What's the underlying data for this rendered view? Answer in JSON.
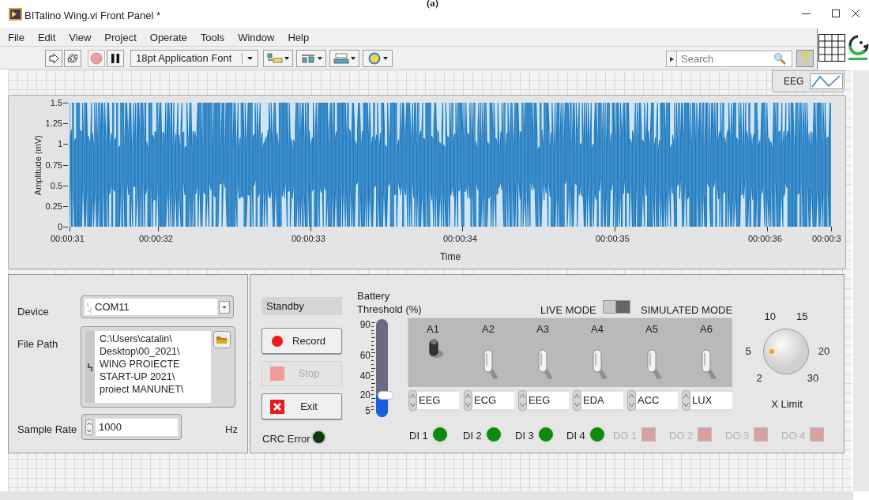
{
  "figure_label": "(a)",
  "window": {
    "title": "BITalino Wing.vi Front Panel *"
  },
  "menu": [
    "File",
    "Edit",
    "View",
    "Project",
    "Operate",
    "Tools",
    "Window",
    "Help"
  ],
  "toolbar": {
    "font": "18pt Application Font"
  },
  "search": {
    "placeholder": "Search"
  },
  "legend": {
    "label": "EEG"
  },
  "chart": {
    "ylabel": "Amplitude (mV)",
    "xlabel": "Time",
    "yticks": [
      "1.5",
      "1.25",
      "1",
      "0.75",
      "0.5",
      "0.25",
      "0"
    ],
    "xticks": [
      "00:00:31",
      "00:00:32",
      "00:00:33",
      "00:00:34",
      "00:00:35",
      "00:00:36",
      "00:00:3"
    ]
  },
  "device": {
    "label": "Device",
    "value": "COM11"
  },
  "file_path": {
    "label": "File Path",
    "lines": [
      "C:\\Users\\catalin\\",
      "Desktop\\00_2021\\",
      "WING PROIECTE",
      "START-UP 2021\\",
      "proiect MANUNET\\"
    ]
  },
  "sample_rate": {
    "label": "Sample Rate",
    "value": "1000",
    "unit": "Hz"
  },
  "status": "Standby",
  "buttons": [
    {
      "label": "Record",
      "kind": "record",
      "disabled": false
    },
    {
      "label": "Stop",
      "kind": "stop",
      "disabled": true
    },
    {
      "label": "Exit",
      "kind": "exit",
      "disabled": false
    }
  ],
  "crc_error": {
    "label": "CRC Error",
    "on": false
  },
  "battery": {
    "label_lines": [
      "Battery",
      "Threshold (%)"
    ],
    "ticks": [
      "90",
      "60",
      "40",
      "20",
      "5"
    ],
    "level": 0.18
  },
  "mode": {
    "left": "LIVE MODE",
    "right": "SIMULATED MODE",
    "simulated": false
  },
  "channels": [
    {
      "name": "A1",
      "on": true,
      "signal": "EEG"
    },
    {
      "name": "A2",
      "on": false,
      "signal": "ECG"
    },
    {
      "name": "A3",
      "on": false,
      "signal": "EEG"
    },
    {
      "name": "A4",
      "on": false,
      "signal": "EDA"
    },
    {
      "name": "A5",
      "on": false,
      "signal": "ACC"
    },
    {
      "name": "A6",
      "on": false,
      "signal": "LUX"
    }
  ],
  "digital_inputs": [
    {
      "label": "DI 1",
      "on": true
    },
    {
      "label": "DI 2",
      "on": true
    },
    {
      "label": "DI 3",
      "on": true
    },
    {
      "label": "DI 4",
      "on": true
    }
  ],
  "digital_outputs": [
    {
      "label": "DO 1",
      "on": false,
      "disabled": true
    },
    {
      "label": "DO 2",
      "on": false,
      "disabled": true
    },
    {
      "label": "DO 3",
      "on": false,
      "disabled": true
    },
    {
      "label": "DO 4",
      "on": false,
      "disabled": true
    }
  ],
  "x_limit": {
    "label": "X Limit",
    "ticks": [
      "2",
      "5",
      "10",
      "15",
      "20",
      "30"
    ]
  }
}
